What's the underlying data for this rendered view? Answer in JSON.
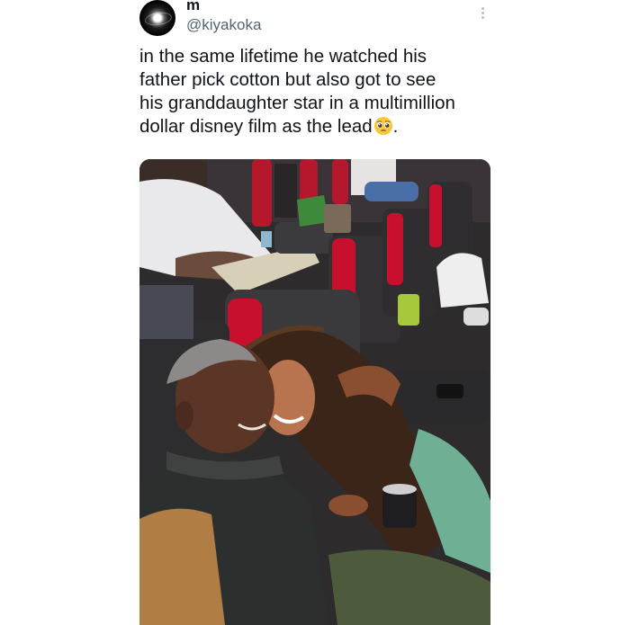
{
  "tweet": {
    "display_name": "m",
    "handle": "@kiyakoka",
    "text": "in the same lifetime he watched his\nfather pick cotton but also got to see\nhis granddaughter star in a multimillion\ndollar disney film as the lead",
    "text_end": ".",
    "emoji": "pleading-face-emoji",
    "more_icon": "more-horizontal-icon"
  },
  "media": {
    "kind": "photo",
    "icon": "photo-image"
  },
  "colors": {
    "text": "#0f1419",
    "secondary": "#536471",
    "seat_red": "#c8102e",
    "seat_dark": "#2a2a2c"
  }
}
